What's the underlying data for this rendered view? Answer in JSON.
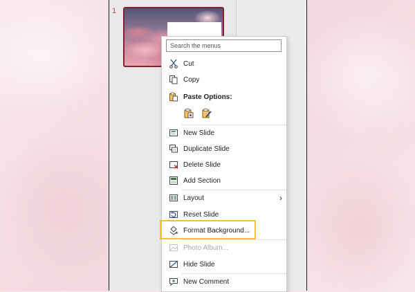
{
  "slides": {
    "number": "1"
  },
  "menu": {
    "search_placeholder": "Search the menus",
    "cut": "Cut",
    "copy": "Copy",
    "paste_options": "Paste Options:",
    "new_slide": "New Slide",
    "duplicate_slide": "Duplicate Slide",
    "delete_slide": "Delete Slide",
    "add_section": "Add Section",
    "layout": "Layout",
    "layout_arrow": "›",
    "reset_slide": "Reset Slide",
    "format_background": "Format Background...",
    "photo_album": "Photo Album...",
    "hide_slide": "Hide Slide",
    "new_comment": "New Comment"
  },
  "colors": {
    "highlight": "#f1c232",
    "selected_thumb_border": "#8a1f2b",
    "slide_number": "#c2453f"
  }
}
